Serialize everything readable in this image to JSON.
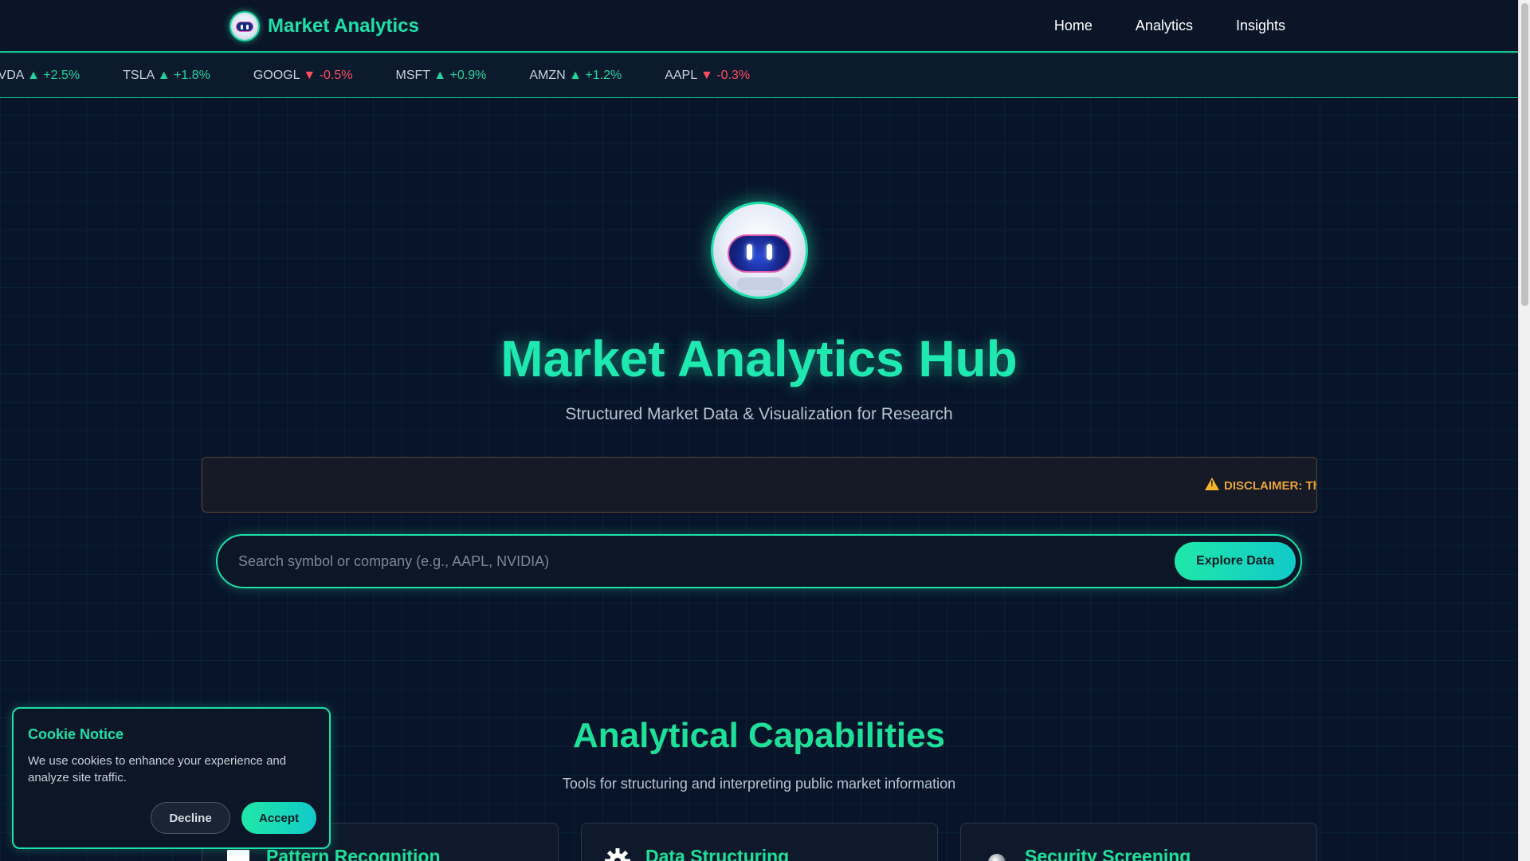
{
  "brand": {
    "name": "Market Analytics"
  },
  "nav": {
    "links": [
      "Home",
      "Analytics",
      "Insights"
    ]
  },
  "ticker": [
    {
      "symbol": "NVDA",
      "arrow": "▲",
      "change": "+2.5%",
      "direction": "up"
    },
    {
      "symbol": "TSLA",
      "arrow": "▲",
      "change": "+1.8%",
      "direction": "up"
    },
    {
      "symbol": "GOOGL",
      "arrow": "▼",
      "change": "-0.5%",
      "direction": "down"
    },
    {
      "symbol": "MSFT",
      "arrow": "▲",
      "change": "+0.9%",
      "direction": "up"
    },
    {
      "symbol": "AMZN",
      "arrow": "▲",
      "change": "+1.2%",
      "direction": "up"
    },
    {
      "symbol": "AAPL",
      "arrow": "▼",
      "change": "-0.3%",
      "direction": "down"
    }
  ],
  "hero": {
    "title": "Market Analytics Hub",
    "subtitle": "Structured Market Data & Visualization for Research",
    "disclaimer": "DISCLAIMER: Th"
  },
  "search": {
    "placeholder": "Search symbol or company (e.g., AAPL, NVIDIA)",
    "value": "",
    "button_label": "Explore Data"
  },
  "capabilities": {
    "title": "Analytical Capabilities",
    "subtitle": "Tools for structuring and interpreting public market information",
    "cards": [
      {
        "title": "Pattern Recognition",
        "icon": "square-icon"
      },
      {
        "title": "Data Structuring",
        "icon": "gear-icon"
      },
      {
        "title": "Security Screening",
        "icon": "sphere-icon"
      }
    ]
  },
  "cookie": {
    "title": "Cookie Notice",
    "text": "We use cookies to enhance your experience and analyze site traffic.",
    "decline_label": "Decline",
    "accept_label": "Accept"
  },
  "colors": {
    "accent": "#1fe0a8",
    "up": "#22d39a",
    "down": "#ff4d5e",
    "warning": "#e8a33a",
    "background": "#08142a"
  }
}
